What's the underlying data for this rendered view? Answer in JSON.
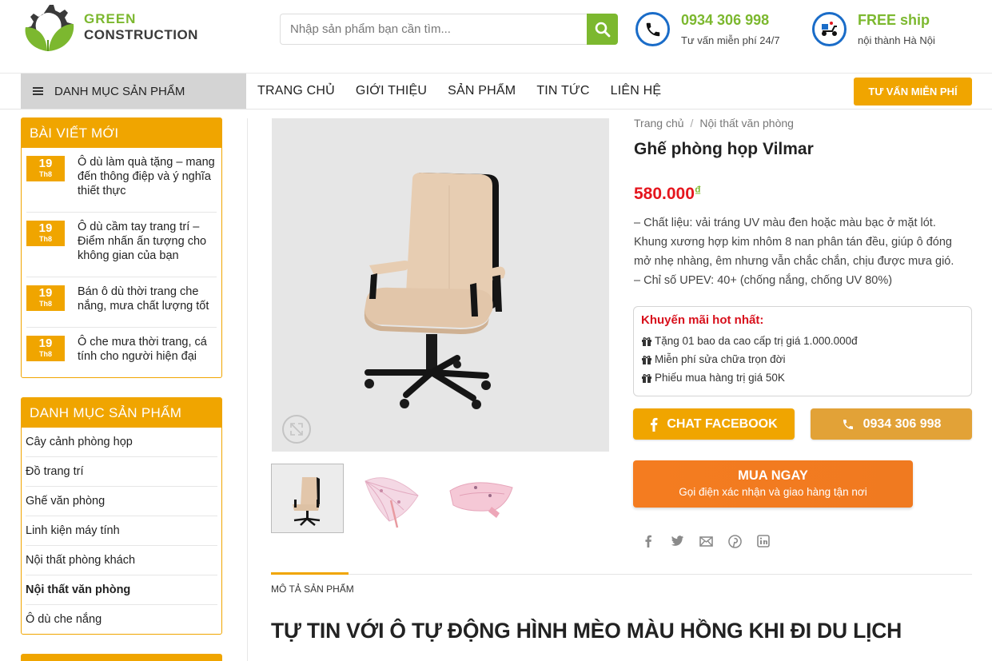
{
  "header": {
    "logo": {
      "line1": "GREEN",
      "line2": "CONSTRUCTION"
    },
    "search": {
      "placeholder": "Nhập sản phẩm bạn cần tìm..."
    },
    "hotline": {
      "number": "0934 306 998",
      "note": "Tư vấn miễn phí 24/7"
    },
    "shipping": {
      "title": "FREE ship",
      "note": "nội thành Hà Nội"
    },
    "colors": {
      "green": "#7cb82f",
      "orange": "#f0a500",
      "blue": "#1a6cc8"
    }
  },
  "nav": {
    "category_label": "DANH MỤC SẢN PHẨM",
    "links": [
      "TRANG CHỦ",
      "GIỚI THIỆU",
      "SẢN PHẨM",
      "TIN TỨC",
      "LIÊN HỆ"
    ],
    "cta": "TƯ VẤN MIỄN PHÍ"
  },
  "sidebar": {
    "recent_posts": {
      "title": "BÀI VIẾT MỚI",
      "posts": [
        {
          "day": "19",
          "month": "Th8",
          "title": "Ô dù làm quà tặng – mang đến thông điệp và ý nghĩa thiết thực"
        },
        {
          "day": "19",
          "month": "Th8",
          "title": "Ô dù cầm tay trang trí – Điểm nhấn ấn tượng cho không gian của bạn"
        },
        {
          "day": "19",
          "month": "Th8",
          "title": "Bán ô dù thời trang che nắng, mưa chất lượng tốt"
        },
        {
          "day": "19",
          "month": "Th8",
          "title": "Ô che mưa thời trang, cá tính cho người hiện đại"
        }
      ]
    },
    "categories": {
      "title": "DANH MỤC SẢN PHẨM",
      "items": [
        "Cây cảnh phòng họp",
        "Đồ trang trí",
        "Ghế văn phòng",
        "Linh kiện máy tính",
        "Nội thất phòng khách",
        "Nội thất văn phòng",
        "Ô dù che nắng"
      ],
      "active_index": 5
    }
  },
  "product": {
    "breadcrumb": [
      "Trang chủ",
      "Nội thất văn phòng"
    ],
    "title": "Ghế phòng họp Vilmar",
    "price": "580.000",
    "currency": "₫",
    "description": [
      "– Chất liệu: vải tráng UV màu đen hoặc màu bạc ở mặt lót.",
      "Khung xương hợp kim nhôm 8 nan phân tán đều, giúp ô đóng mở nhẹ nhàng, êm nhưng vẫn chắc chắn, chịu được mưa gió.",
      "– Chỉ số UPEV: 40+ (chống nắng, chống UV 80%)"
    ],
    "promo": {
      "title": "Khuyến mãi hot nhất:",
      "items": [
        "Tặng 01 bao da cao cấp trị giá 1.000.000đ",
        "Miễn phí sửa chữa trọn đời",
        "Phiếu mua hàng trị giá 50K"
      ]
    },
    "buttons": {
      "facebook": "CHAT FACEBOOK",
      "phone": "0934 306 998",
      "buy": "MUA NGAY",
      "buy_sub": "Gọi điện xác nhận và giao hàng tận nơi"
    },
    "share_icons": [
      "facebook-icon",
      "twitter-icon",
      "email-icon",
      "pinterest-icon",
      "linkedin-icon"
    ]
  },
  "tabs": {
    "active_label": "MÔ TẢ SẢN PHẨM",
    "content_title": "TỰ TIN VỚI Ô TỰ ĐỘNG HÌNH MÈO MÀU HỒNG KHI ĐI DU LỊCH"
  }
}
